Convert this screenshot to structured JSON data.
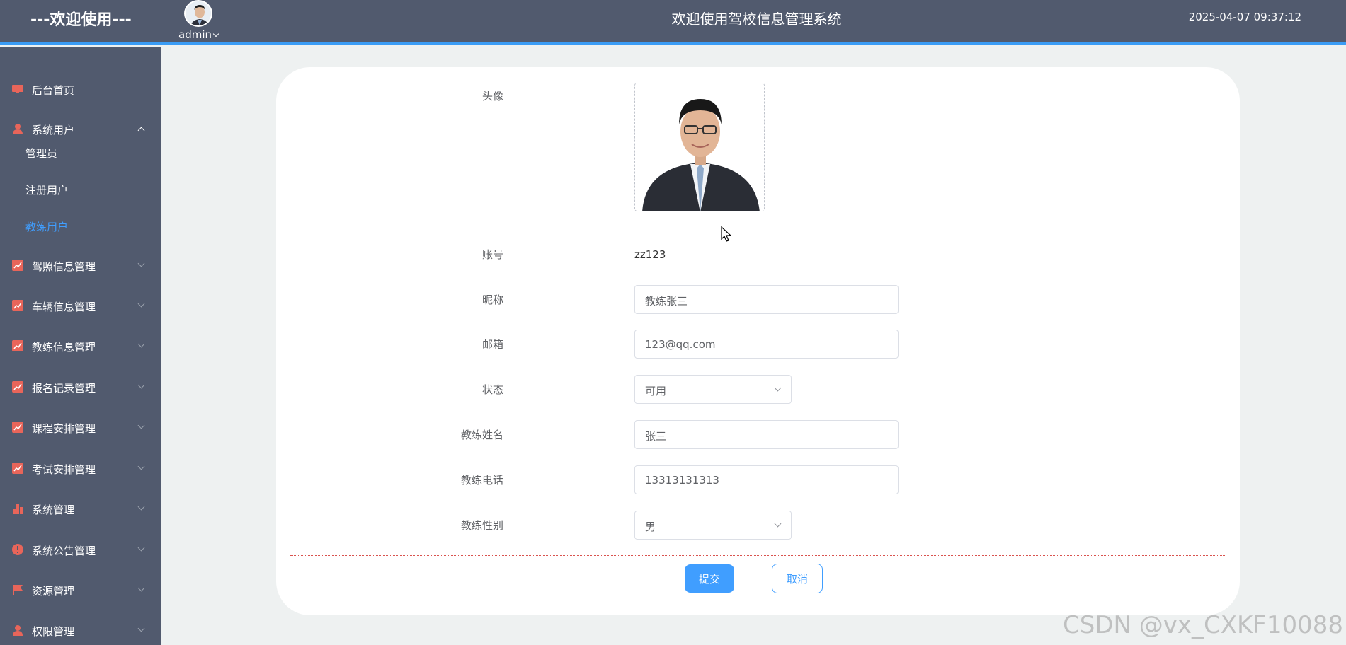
{
  "header": {
    "brand": "---欢迎使用---",
    "username": "admin",
    "title": "欢迎使用驾校信息管理系统",
    "datetime": "2025-04-07 09:37:12"
  },
  "sidebar": {
    "items": [
      {
        "label": "后台首页",
        "icon": "monitor-icon"
      },
      {
        "label": "系统用户",
        "icon": "user-icon",
        "expanded": true,
        "children": [
          {
            "label": "管理员"
          },
          {
            "label": "注册用户"
          },
          {
            "label": "教练用户",
            "active": true
          }
        ]
      },
      {
        "label": "驾照信息管理",
        "icon": "chart-icon"
      },
      {
        "label": "车辆信息管理",
        "icon": "chart-icon"
      },
      {
        "label": "教练信息管理",
        "icon": "chart-icon"
      },
      {
        "label": "报名记录管理",
        "icon": "chart-icon"
      },
      {
        "label": "课程安排管理",
        "icon": "chart-icon"
      },
      {
        "label": "考试安排管理",
        "icon": "chart-icon"
      },
      {
        "label": "系统管理",
        "icon": "bar-chart-icon"
      },
      {
        "label": "系统公告管理",
        "icon": "alert-icon"
      },
      {
        "label": "资源管理",
        "icon": "flag-icon"
      },
      {
        "label": "权限管理",
        "icon": "user-icon"
      }
    ]
  },
  "form": {
    "avatar_label": "头像",
    "account_label": "账号",
    "account_value": "zz123",
    "nickname_label": "昵称",
    "nickname_value": "教练张三",
    "email_label": "邮箱",
    "email_value": "123@qq.com",
    "status_label": "状态",
    "status_value": "可用",
    "name_label": "教练姓名",
    "name_value": "张三",
    "phone_label": "教练电话",
    "phone_value": "13313131313",
    "gender_label": "教练性别",
    "gender_value": "男",
    "submit_label": "提交",
    "cancel_label": "取消"
  },
  "colors": {
    "sidebar_bg": "#515a6e",
    "accent": "#409eff",
    "menu_icon": "#e8655a"
  },
  "watermark": "CSDN @vx_CXKF10088"
}
